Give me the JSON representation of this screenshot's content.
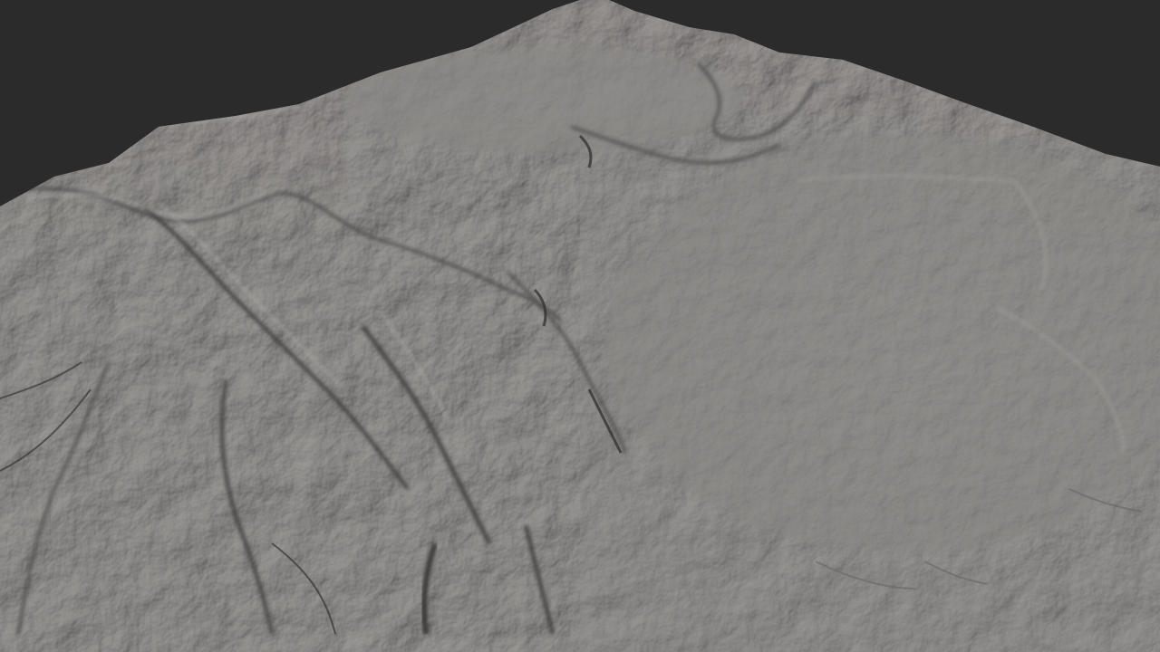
{
  "viewport": {
    "background_color": "#2b2b2b",
    "mesh_color": "#8e8c89",
    "mesh_highlight_color": "#aaa8a5",
    "mesh_shadow_color": "#3a3938"
  }
}
